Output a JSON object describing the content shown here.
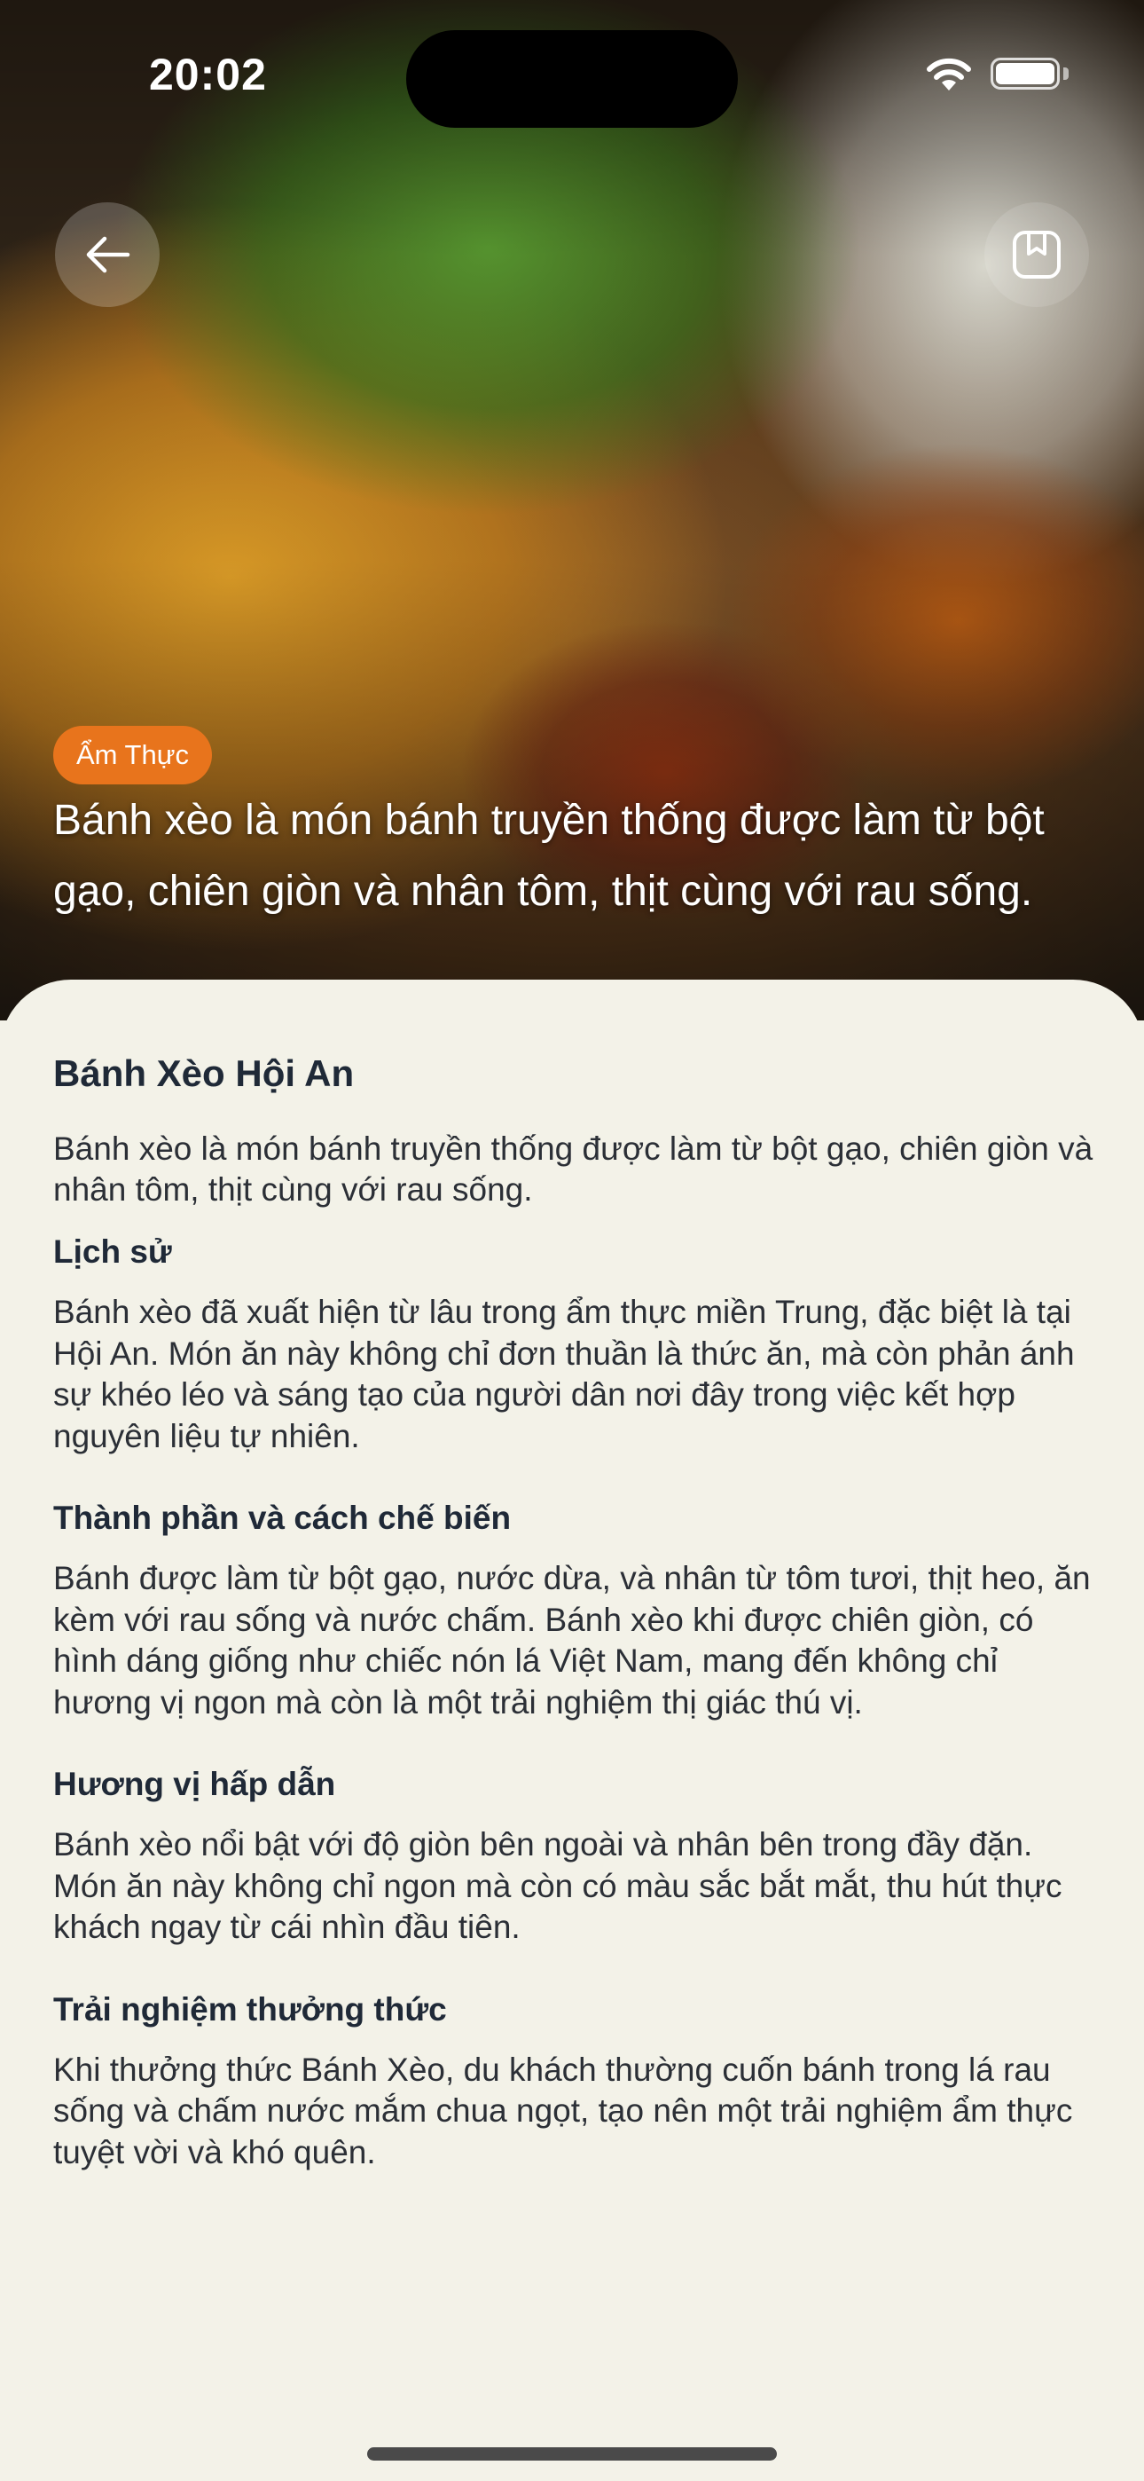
{
  "status_bar": {
    "time": "20:02"
  },
  "hero": {
    "category_tag": "Ẩm Thực",
    "caption": "Bánh xèo là món bánh truyền thống được làm từ bột gạo, chiên giòn và nhân tôm, thịt cùng với rau sống.",
    "back_icon": "arrow-left-icon",
    "bookmark_icon": "bookmark-icon"
  },
  "article": {
    "title": "Bánh Xèo Hội An",
    "description": "Bánh xèo là món bánh truyền thống được làm từ bột gạo, chiên giòn và nhân tôm, thịt cùng với rau sống.",
    "sections": [
      {
        "heading": "Lịch sử",
        "body": "Bánh xèo đã xuất hiện từ lâu trong ẩm thực miền Trung, đặc biệt là tại Hội An. Món ăn này không chỉ đơn thuần là thức ăn, mà còn phản ánh sự khéo léo và sáng tạo của người dân nơi đây trong việc kết hợp nguyên liệu tự nhiên."
      },
      {
        "heading": "Thành phần và cách chế biến",
        "body": "Bánh được làm từ bột gạo, nước dừa, và nhân từ tôm tươi, thịt heo, ăn kèm với rau sống và nước chấm. Bánh xèo khi được chiên giòn, có hình dáng giống như chiếc nón lá Việt Nam, mang đến không chỉ hương vị ngon mà còn là một trải nghiệm thị giác thú vị."
      },
      {
        "heading": "Hương vị hấp dẫn",
        "body": "Bánh xèo nổi bật với độ giòn bên ngoài và nhân bên trong đầy đặn. Món ăn này không chỉ ngon mà còn có màu sắc bắt mắt, thu hút thực khách ngay từ cái nhìn đầu tiên."
      },
      {
        "heading": "Trải nghiệm thưởng thức",
        "body": "Khi thưởng thức Bánh Xèo, du khách thường cuốn bánh trong lá rau sống và chấm nước mắm chua ngọt, tạo nên một trải nghiệm ẩm thực tuyệt vời và khó quên."
      }
    ]
  },
  "colors": {
    "accent": "#e8741c",
    "background": "#f3f2e8",
    "text": "#1f2937"
  }
}
